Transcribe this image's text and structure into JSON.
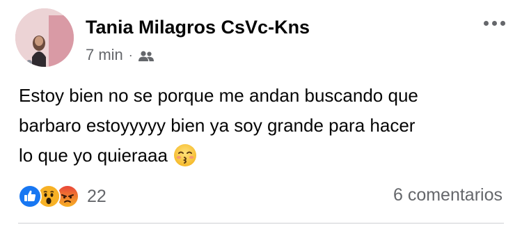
{
  "post": {
    "author": "Tania Milagros CsVc-Kns",
    "timestamp": "7 min",
    "separator": "·",
    "audience_icon": "friends-icon",
    "body_lines": [
      "Estoy bien no se porque me andan buscando que",
      "barbaro estoyyyyy bien ya soy grande para hacer",
      "lo que yo quieraaa"
    ],
    "emoji": "kissing-face-emoji",
    "reactions": {
      "types": [
        "like",
        "wow",
        "angry"
      ],
      "count": "22"
    },
    "comments_label": "6 comentarios"
  },
  "colors": {
    "text_primary": "#050505",
    "text_secondary": "#65676b",
    "like_blue": "#1877f2",
    "wow_yellow": "#f7b125",
    "angry_red": "#e9710f"
  }
}
